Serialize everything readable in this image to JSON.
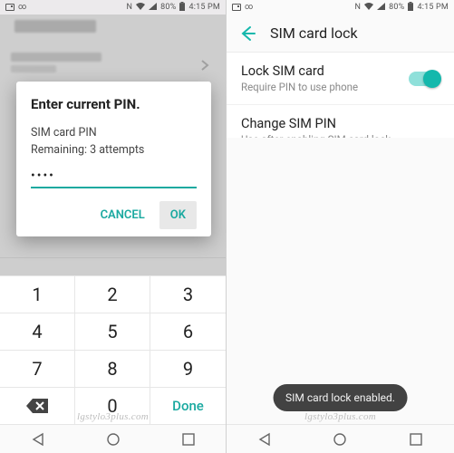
{
  "status": {
    "battery_pct": "80%",
    "time": "4:15 PM"
  },
  "left": {
    "dialog": {
      "title": "Enter current PIN.",
      "label": "SIM card PIN",
      "remaining": "Remaining: 3 attempts",
      "pin_value": "••••",
      "cancel": "CANCEL",
      "ok": "OK"
    },
    "keypad": {
      "k1": "1",
      "k2": "2",
      "k3": "3",
      "k4": "4",
      "k5": "5",
      "k6": "6",
      "k7": "7",
      "k8": "8",
      "k9": "9",
      "k0": "0",
      "done": "Done"
    }
  },
  "right": {
    "title": "SIM card lock",
    "item1": {
      "title": "Lock SIM card",
      "subtitle": "Require PIN to use phone"
    },
    "item2": {
      "title": "Change SIM PIN",
      "subtitle": "Use after enabling SIM card lock"
    },
    "toast": "SIM card lock enabled."
  },
  "watermark": "lgstylo3plus.com"
}
